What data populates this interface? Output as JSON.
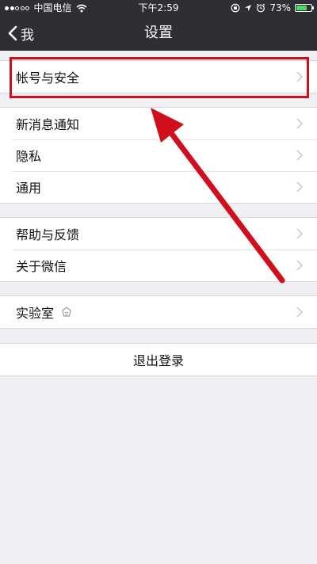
{
  "status_bar": {
    "carrier": "中国电信",
    "time": "下午2:59",
    "battery_percent": "73%",
    "battery_level": 0.73,
    "signal_bars_filled": 2,
    "signal_bars_total": 5,
    "icons": [
      "wifi-icon",
      "orientation-lock-icon",
      "location-icon",
      "alarm-icon",
      "battery-icon"
    ]
  },
  "nav": {
    "back_label": "我",
    "title": "设置"
  },
  "groups": {
    "account": {
      "items": [
        {
          "label": "帐号与安全"
        }
      ]
    },
    "general": {
      "items": [
        {
          "label": "新消息通知"
        },
        {
          "label": "隐私"
        },
        {
          "label": "通用"
        }
      ]
    },
    "support": {
      "items": [
        {
          "label": "帮助与反馈"
        },
        {
          "label": "关于微信"
        }
      ]
    },
    "lab": {
      "items": [
        {
          "label": "实验室",
          "icon": "lab-icon"
        }
      ]
    },
    "logout": {
      "label": "退出登录"
    }
  },
  "annotation": {
    "color": "#d10f1c",
    "target": "帐号与安全"
  },
  "colors": {
    "navbar": "#2f2f33",
    "background": "#efeff4",
    "battery": "#4cd964"
  }
}
